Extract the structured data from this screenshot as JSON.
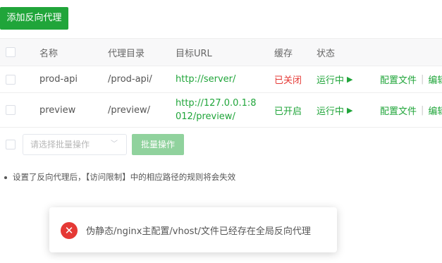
{
  "toolbar": {
    "add_label": "添加反向代理"
  },
  "table": {
    "headers": {
      "name": "名称",
      "path": "代理目录",
      "url": "目标URL",
      "cache": "缓存",
      "status": "状态"
    },
    "rows": [
      {
        "name": "prod-api",
        "path": "/prod-api/",
        "url": "http://server/",
        "cache": "已关闭",
        "status": "运行中",
        "config": "配置文件",
        "edit": "编辑"
      },
      {
        "name": "preview",
        "path": "/preview/",
        "url": "http://127.0.0.1:8012/preview/",
        "cache": "已开启",
        "status": "运行中",
        "config": "配置文件",
        "edit": "编辑"
      }
    ]
  },
  "batch": {
    "placeholder": "请选择批量操作",
    "button": "批量操作"
  },
  "note": "设置了反向代理后，【访问限制】中的相应路径的规则将会失效",
  "toast": {
    "message": "伪静态/nginx主配置/vhost/文件已经存在全局反向代理"
  },
  "colors": {
    "accent": "#20a53a",
    "error": "#e53935"
  }
}
